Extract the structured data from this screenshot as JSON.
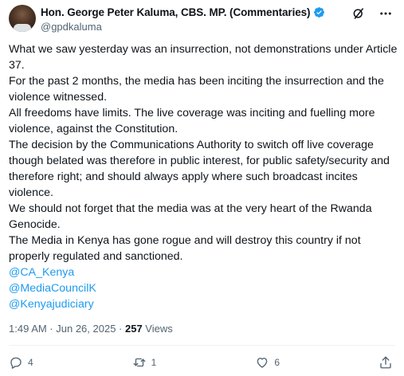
{
  "author": {
    "name": "Hon. George Peter Kaluma, CBS. MP. (Commentaries)",
    "handle": "@gpdkaluma",
    "verified": true,
    "verified_color": "#1d9bf0"
  },
  "post": {
    "paragraphs": [
      "What we saw yesterday was an insurrection, not demonstrations under Article 37.",
      "For the past 2 months, the media has been inciting the insurrection and the violence witnessed.",
      "All freedoms have limits. The live coverage was inciting and fuelling more violence, against the Constitution.",
      "The decision by the Communications Authority to switch off live coverage though belated was therefore in public interest, for public safety/security and therefore right; and should always apply where such broadcast incites violence.",
      "We should not forget that the media was at the very heart of the Rwanda Genocide.",
      "The Media in Kenya has gone rogue and will destroy this country if not properly regulated and sanctioned."
    ],
    "mentions": [
      "@CA_Kenya",
      "@MediaCouncilK",
      "@Kenyajudiciary"
    ],
    "timestamp": "1:49 AM · Jun 26, 2025 · ",
    "views_count": "257",
    "views_label": " Views"
  },
  "actions": {
    "replies": "4",
    "reposts": "1",
    "likes": "6"
  },
  "icons": [
    "grok-icon",
    "more-icon",
    "reply-icon",
    "repost-icon",
    "like-icon",
    "share-icon"
  ],
  "colors": {
    "link": "#1d9bf0",
    "secondary_text": "#536471"
  }
}
